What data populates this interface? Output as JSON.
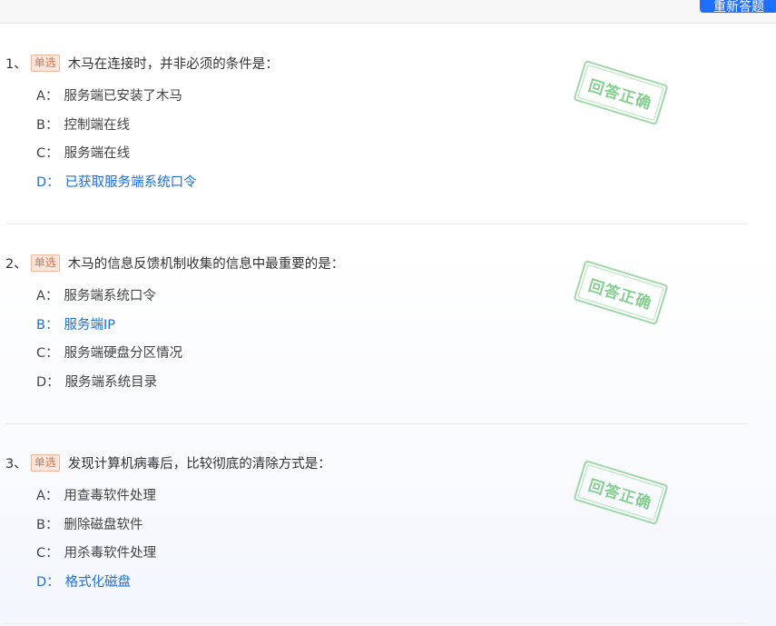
{
  "toolbar": {
    "redo_label": "重新答题"
  },
  "questions": [
    {
      "number": "1、",
      "tag": "单选",
      "text": "木马在连接时，并非必须的条件是：",
      "stamp": "回答正确",
      "options": [
        {
          "letter": "A：",
          "text": "服务端已安装了木马",
          "correct": false
        },
        {
          "letter": "B：",
          "text": "控制端在线",
          "correct": false
        },
        {
          "letter": "C：",
          "text": "服务端在线",
          "correct": false
        },
        {
          "letter": "D：",
          "text": "已获取服务端系统口令",
          "correct": true
        }
      ]
    },
    {
      "number": "2、",
      "tag": "单选",
      "text": "木马的信息反馈机制收集的信息中最重要的是：",
      "stamp": "回答正确",
      "options": [
        {
          "letter": "A：",
          "text": "服务端系统口令",
          "correct": false
        },
        {
          "letter": "B：",
          "text": "服务端IP",
          "correct": true
        },
        {
          "letter": "C：",
          "text": "服务端硬盘分区情况",
          "correct": false
        },
        {
          "letter": "D：",
          "text": "服务端系统目录",
          "correct": false
        }
      ]
    },
    {
      "number": "3、",
      "tag": "单选",
      "text": "发现计算机病毒后，比较彻底的清除方式是：",
      "stamp": "回答正确",
      "options": [
        {
          "letter": "A：",
          "text": "用查毒软件处理",
          "correct": false
        },
        {
          "letter": "B：",
          "text": "删除磁盘软件",
          "correct": false
        },
        {
          "letter": "C：",
          "text": "用杀毒软件处理",
          "correct": false
        },
        {
          "letter": "D：",
          "text": "格式化磁盘",
          "correct": true
        }
      ]
    }
  ],
  "colors": {
    "accent": "#1e6fff",
    "correct_option": "#1e6fd9",
    "tag": "#f26b3a",
    "stamp": "#86cf90"
  }
}
